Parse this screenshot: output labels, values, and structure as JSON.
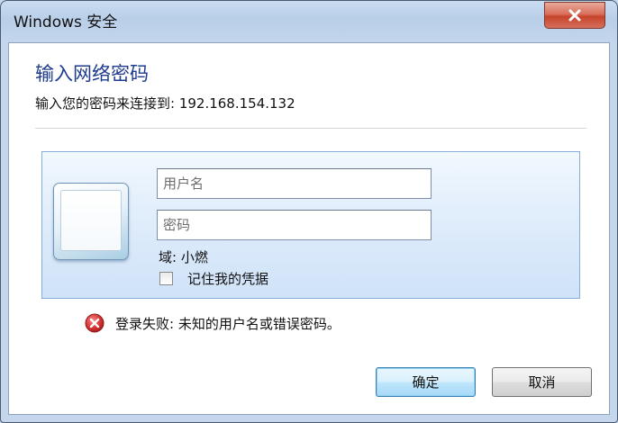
{
  "window": {
    "title": "Windows 安全",
    "close_icon": "close-icon"
  },
  "dialog": {
    "heading": "输入网络密码",
    "subtext": "输入您的密码来连接到: 192.168.154.132"
  },
  "credentials": {
    "avatar_icon": "user-tile-icon",
    "username_placeholder": "用户名",
    "password_placeholder": "密码",
    "domain_label": "域: 小燃",
    "remember_label": "记住我的凭据",
    "remember_checked": false
  },
  "error": {
    "icon": "error-icon",
    "message": "登录失败: 未知的用户名或错误密码。"
  },
  "buttons": {
    "ok_label": "确定",
    "cancel_label": "取消"
  },
  "colors": {
    "heading": "#1e3c8c",
    "close_button": "#c7432b",
    "error_icon": "#c62a2a"
  }
}
